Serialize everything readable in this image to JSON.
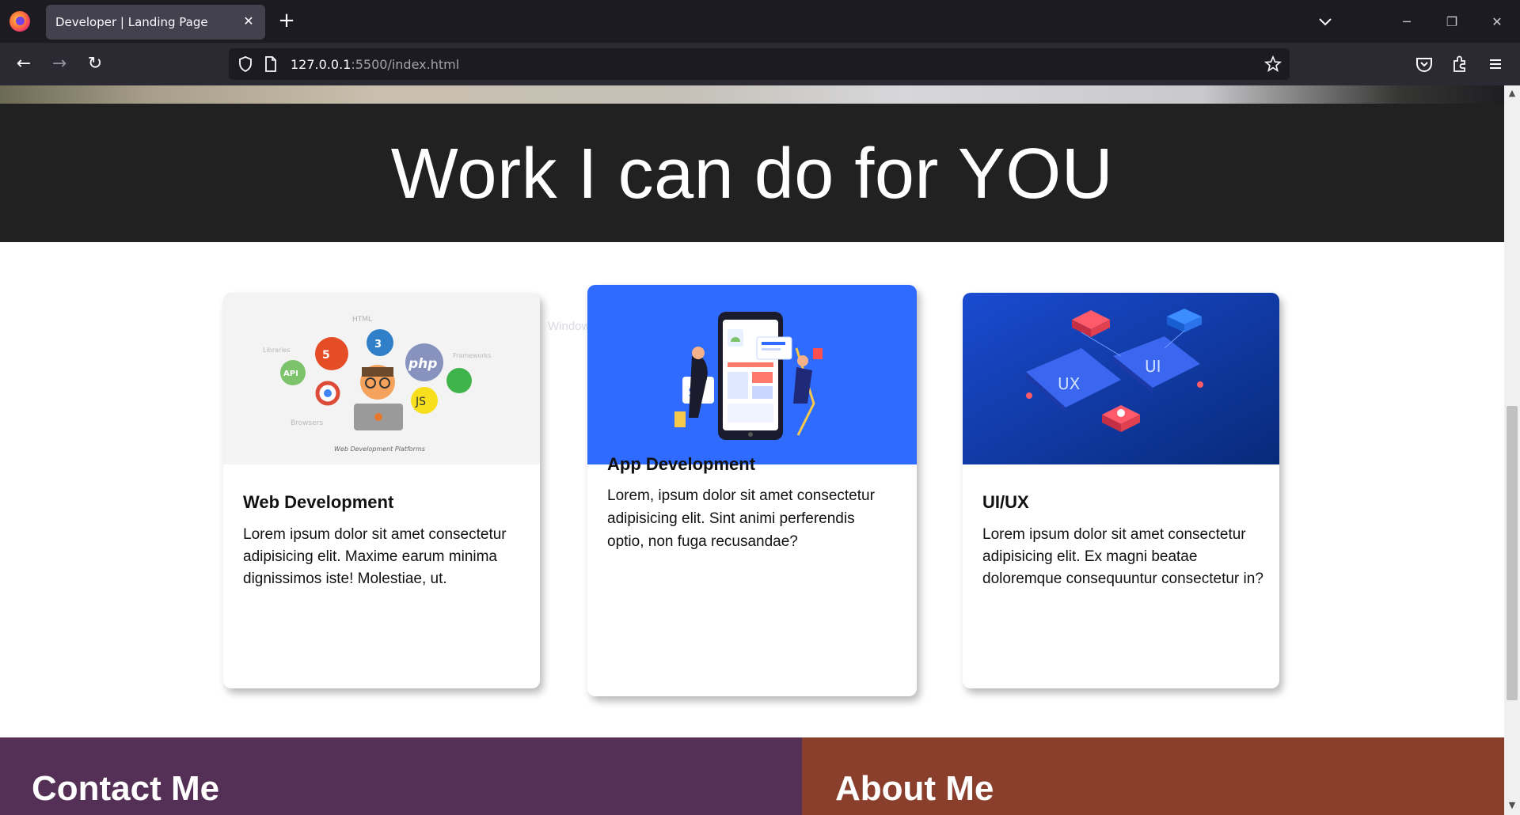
{
  "browser": {
    "tab_title": "Developer | Landing Page",
    "url_host": "127.0.0.1",
    "url_rest": ":5500/index.html"
  },
  "page": {
    "section_title": "Work I can do for YOU",
    "ghost_text": "Window Snip",
    "cards": [
      {
        "title": "Web Development",
        "text": "Lorem ipsum dolor sit amet consectetur adipisicing elit. Maxime earum minima dignissimos iste! Molestiae, ut.",
        "image_labels": [
          "HTML",
          "API",
          "php",
          "JS",
          "Libraries",
          "Frameworks",
          "Browsers",
          "Web Development Platforms"
        ]
      },
      {
        "title": "App Development",
        "text": "Lorem, ipsum dolor sit amet consectetur adipisicing elit. Sint animi perferendis optio, non fuga recusandae?"
      },
      {
        "title": "UI/UX",
        "text": "Lorem ipsum dolor sit amet consectetur adipisicing elit. Ex magni beatae doloremque consequuntur consectetur in?",
        "image_labels": [
          "UX",
          "UI"
        ]
      }
    ],
    "contact_title": "Contact Me",
    "about_title": "About Me"
  },
  "colors": {
    "header_bg": "#212121",
    "contact_bg": "#553056",
    "about_bg": "#8a3f2d",
    "app_card_bg": "#2f6bff"
  }
}
